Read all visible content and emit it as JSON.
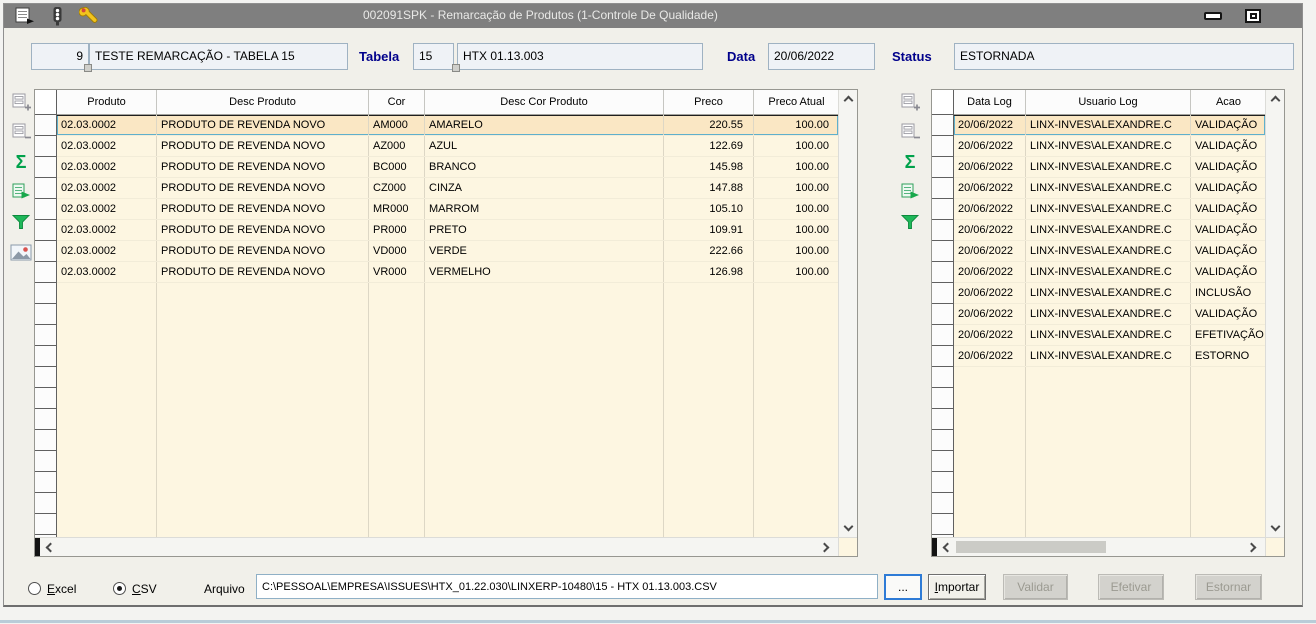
{
  "titlebar": {
    "title": "002091SPK - Remarcação de Produtos (1-Controle De Qualidade)",
    "icons": [
      "report-icon",
      "traffic-light-icon",
      "wrench-icon"
    ]
  },
  "header": {
    "record_number": "9",
    "record_description": "TESTE REMARCAÇÃO - TABELA 15",
    "tabela_label": "Tabela",
    "tabela_value": "15",
    "tabela_description": "HTX 01.13.003",
    "data_label": "Data",
    "data_value": "20/06/2022",
    "status_label": "Status",
    "status_value": "ESTORNADA"
  },
  "products_toolbar": [
    "add-record-icon",
    "remove-record-icon",
    "sum-icon",
    "export-icon",
    "filter-icon",
    "image-icon"
  ],
  "log_toolbar": [
    "add-record-icon",
    "remove-record-icon",
    "sum-icon",
    "export-icon",
    "filter-icon"
  ],
  "products_grid": {
    "columns": [
      "Produto",
      "Desc Produto",
      "Cor",
      "Desc Cor Produto",
      "Preco",
      "Preco Atual"
    ],
    "selected_row": 0,
    "rows": [
      [
        "02.03.0002",
        "PRODUTO DE REVENDA NOVO",
        "AM000",
        "AMARELO",
        "220.55",
        "100.00"
      ],
      [
        "02.03.0002",
        "PRODUTO DE REVENDA NOVO",
        "AZ000",
        "AZUL",
        "122.69",
        "100.00"
      ],
      [
        "02.03.0002",
        "PRODUTO DE REVENDA NOVO",
        "BC000",
        "BRANCO",
        "145.98",
        "100.00"
      ],
      [
        "02.03.0002",
        "PRODUTO DE REVENDA NOVO",
        "CZ000",
        "CINZA",
        "147.88",
        "100.00"
      ],
      [
        "02.03.0002",
        "PRODUTO DE REVENDA NOVO",
        "MR000",
        "MARROM",
        "105.10",
        "100.00"
      ],
      [
        "02.03.0002",
        "PRODUTO DE REVENDA NOVO",
        "PR000",
        "PRETO",
        "109.91",
        "100.00"
      ],
      [
        "02.03.0002",
        "PRODUTO DE REVENDA NOVO",
        "VD000",
        "VERDE",
        "222.66",
        "100.00"
      ],
      [
        "02.03.0002",
        "PRODUTO DE REVENDA NOVO",
        "VR000",
        "VERMELHO",
        "126.98",
        "100.00"
      ]
    ]
  },
  "log_grid": {
    "columns": [
      "Data Log",
      "Usuario Log",
      "Acao"
    ],
    "selected_row": 0,
    "rows": [
      [
        "20/06/2022",
        "LINX-INVES\\ALEXANDRE.C",
        "VALIDAÇÃO"
      ],
      [
        "20/06/2022",
        "LINX-INVES\\ALEXANDRE.C",
        "VALIDAÇÃO"
      ],
      [
        "20/06/2022",
        "LINX-INVES\\ALEXANDRE.C",
        "VALIDAÇÃO"
      ],
      [
        "20/06/2022",
        "LINX-INVES\\ALEXANDRE.C",
        "VALIDAÇÃO"
      ],
      [
        "20/06/2022",
        "LINX-INVES\\ALEXANDRE.C",
        "VALIDAÇÃO"
      ],
      [
        "20/06/2022",
        "LINX-INVES\\ALEXANDRE.C",
        "VALIDAÇÃO"
      ],
      [
        "20/06/2022",
        "LINX-INVES\\ALEXANDRE.C",
        "VALIDAÇÃO"
      ],
      [
        "20/06/2022",
        "LINX-INVES\\ALEXANDRE.C",
        "VALIDAÇÃO"
      ],
      [
        "20/06/2022",
        "LINX-INVES\\ALEXANDRE.C",
        "INCLUSÃO"
      ],
      [
        "20/06/2022",
        "LINX-INVES\\ALEXANDRE.C",
        "VALIDAÇÃO"
      ],
      [
        "20/06/2022",
        "LINX-INVES\\ALEXANDRE.C",
        "EFETIVAÇÃO"
      ],
      [
        "20/06/2022",
        "LINX-INVES\\ALEXANDRE.C",
        "ESTORNO"
      ]
    ]
  },
  "footer": {
    "format_options": [
      {
        "label": "Excel",
        "selected": false,
        "underline_first": true
      },
      {
        "label": "CSV",
        "selected": true,
        "underline_first": true
      }
    ],
    "arquivo_label": "Arquivo",
    "arquivo_path": "C:\\PESSOAL\\EMPRESA\\ISSUES\\HTX_01.22.030\\LINXERP-10480\\15 - HTX 01.13.003.CSV",
    "browse_button": "...",
    "action_buttons": [
      {
        "label": "Importar",
        "enabled": true,
        "underline_first": true
      },
      {
        "label": "Validar",
        "enabled": false,
        "underline_first": false
      },
      {
        "label": "Efetivar",
        "enabled": false,
        "underline_first": false
      },
      {
        "label": "Estornar",
        "enabled": false,
        "underline_first": false
      }
    ]
  },
  "colors": {
    "titlebar_bg": "#7f7f7f",
    "window_bg": "#f1f0ea",
    "row_bg": "#fdf6e1",
    "selected_row_bg": "#fae7c4",
    "label_color": "#00008B",
    "accent_green": "#00a14b",
    "focus_border": "#2e7bd6"
  }
}
